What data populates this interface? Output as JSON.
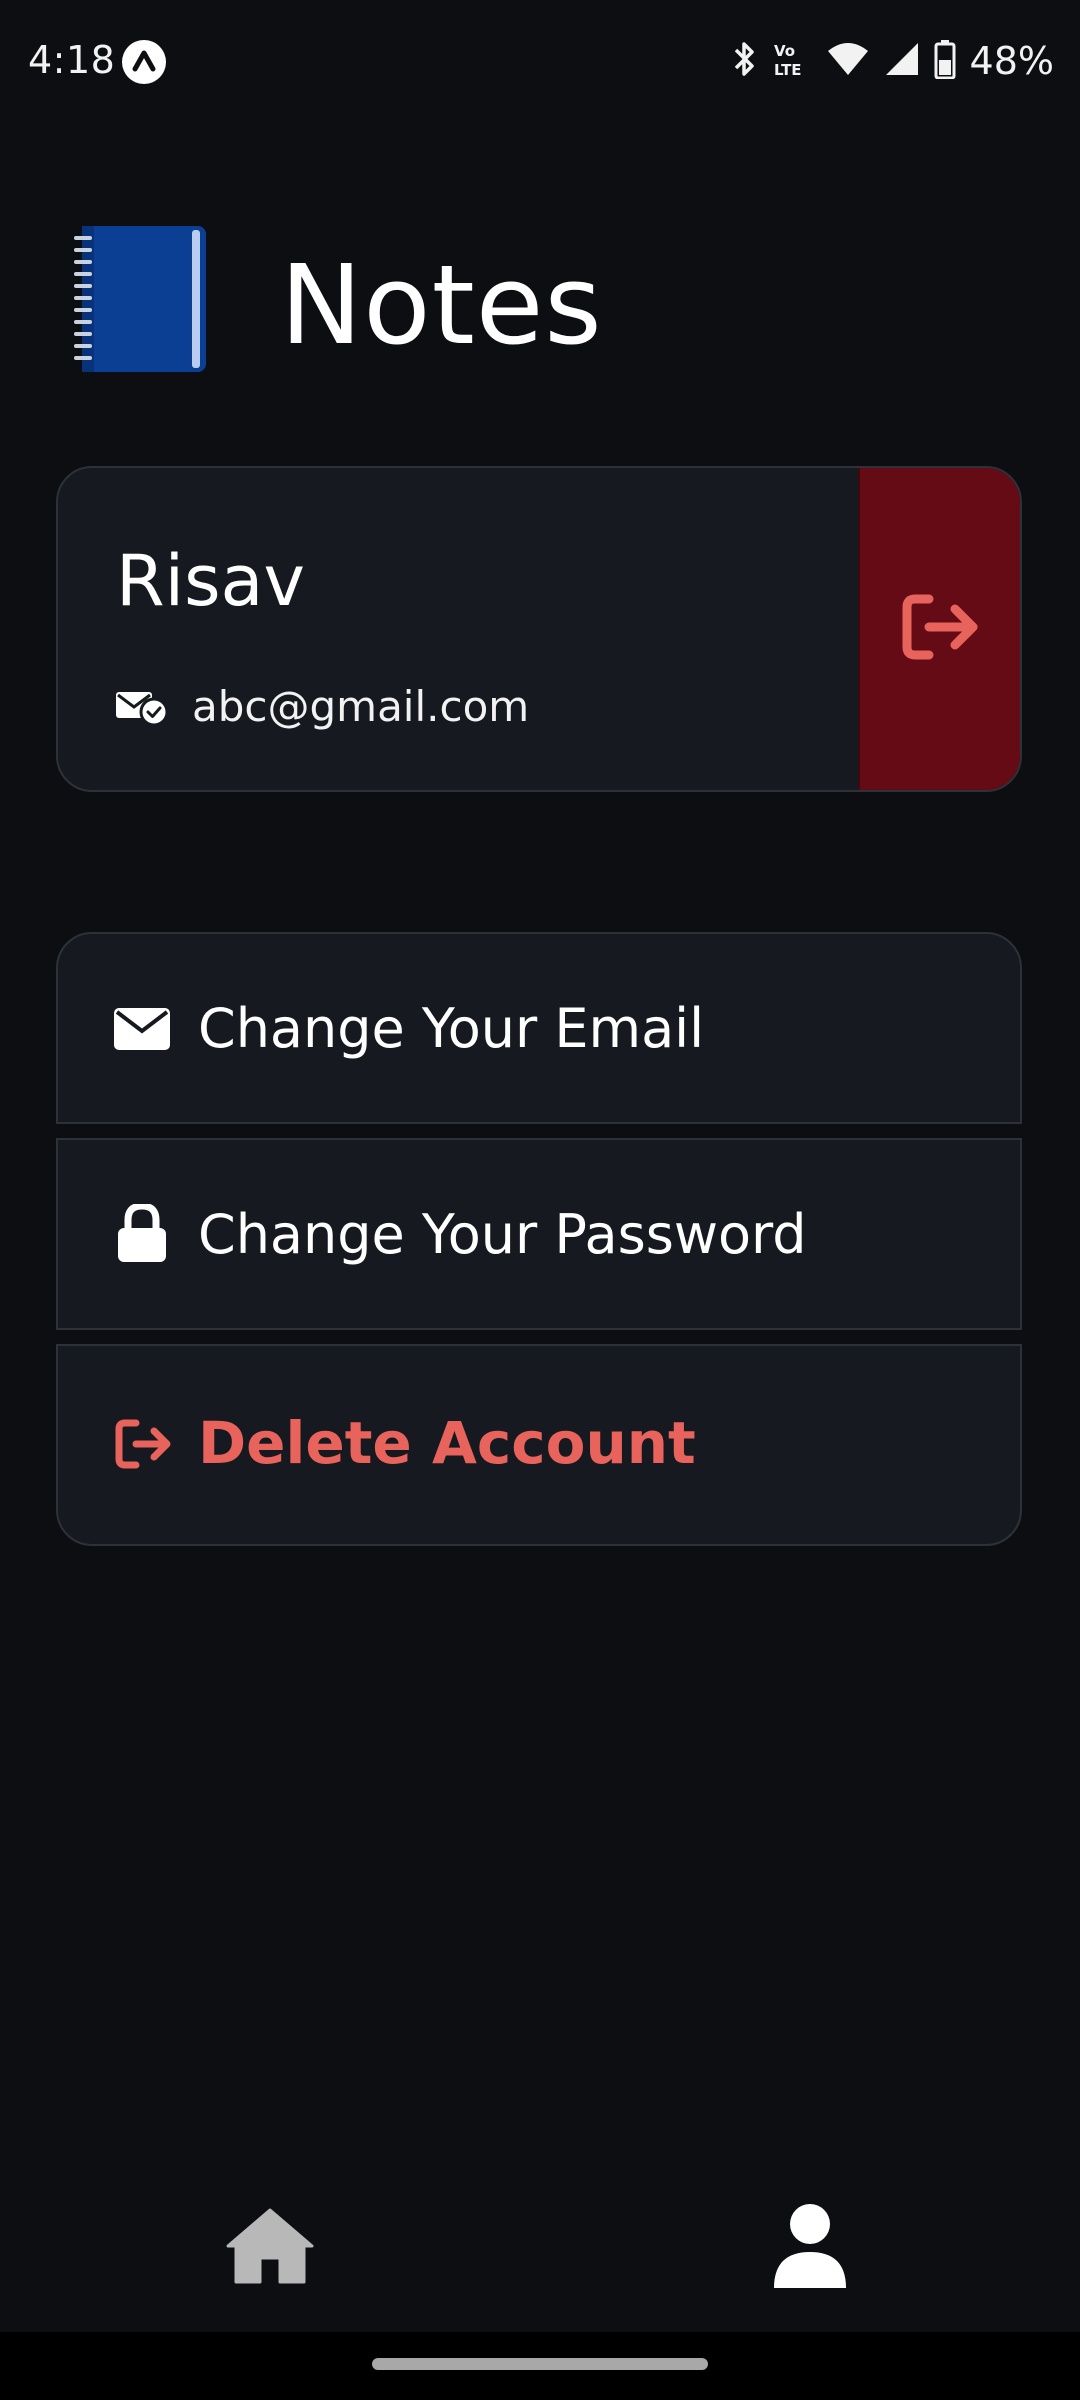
{
  "status_bar": {
    "time": "4:18",
    "battery": "48%",
    "icons": [
      "app-notification-icon",
      "bluetooth-icon",
      "volte-icon",
      "wifi-icon",
      "signal-icon",
      "battery-icon"
    ]
  },
  "header": {
    "title": "Notes",
    "logo_icon": "notebook-icon"
  },
  "profile": {
    "name": "Risav",
    "email": "abc@gmail.com",
    "email_icon": "verified-email-icon",
    "logout_icon": "logout-icon"
  },
  "menu": {
    "items": [
      {
        "label": "Change Your Email",
        "icon": "envelope-icon"
      },
      {
        "label": "Change Your Password",
        "icon": "lock-icon"
      },
      {
        "label": "Delete Account",
        "icon": "logout-icon"
      }
    ]
  },
  "bottom_nav": {
    "items": [
      {
        "icon": "home-icon",
        "active": false
      },
      {
        "icon": "user-icon",
        "active": true
      }
    ]
  },
  "colors": {
    "background": "#0c0e12",
    "card": "#161a20",
    "card_border": "#2d3238",
    "danger": "#e8635c",
    "logout_bg": "#640b16",
    "notebook_blue": "#0b3f94"
  }
}
